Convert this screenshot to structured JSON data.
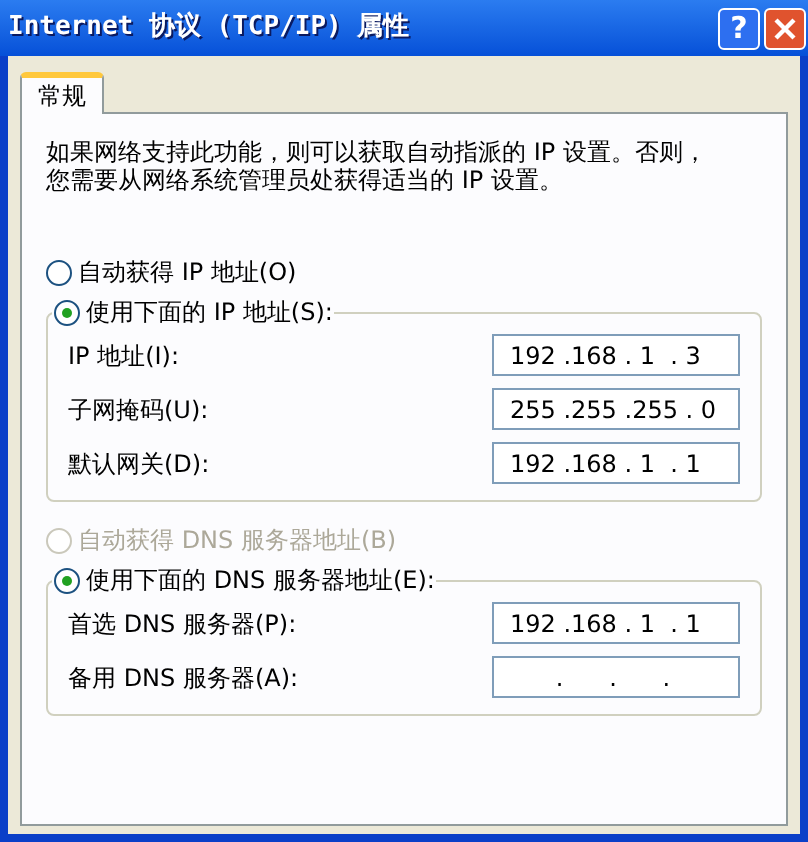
{
  "window": {
    "title": "Internet 协议 (TCP/IP) 属性",
    "controls": [
      {
        "kind": "help",
        "label": "?"
      },
      {
        "kind": "close"
      }
    ]
  },
  "tabs": [
    {
      "label": "常规",
      "selected": true
    }
  ],
  "description_lines": [
    "如果网络支持此功能，则可以获取自动指派的 IP 设置。否则，",
    "您需要从网络系统管理员处获得适当的 IP 设置。"
  ],
  "sections": [
    {
      "auto_option": {
        "label": "自动获得 IP 地址(O)",
        "selected": false,
        "disabled": false
      },
      "manual_option": {
        "label": "使用下面的 IP 地址(S):",
        "selected": true,
        "disabled": false
      },
      "fields": [
        {
          "label": "IP 地址(I):",
          "value": "192 .168 . 1  . 3"
        },
        {
          "label": "子网掩码(U):",
          "value": "255 .255 .255 . 0"
        },
        {
          "label": "默认网关(D):",
          "value": "192 .168 . 1  . 1"
        }
      ]
    },
    {
      "auto_option": {
        "label": "自动获得 DNS 服务器地址(B)",
        "selected": false,
        "disabled": true
      },
      "manual_option": {
        "label": "使用下面的 DNS 服务器地址(E):",
        "selected": true,
        "disabled": false
      },
      "fields": [
        {
          "label": "首选 DNS 服务器(P):",
          "value": "192 .168 . 1  . 1"
        },
        {
          "label": "备用 DNS 服务器(A):",
          "value": "      .      .      ."
        }
      ]
    }
  ]
}
